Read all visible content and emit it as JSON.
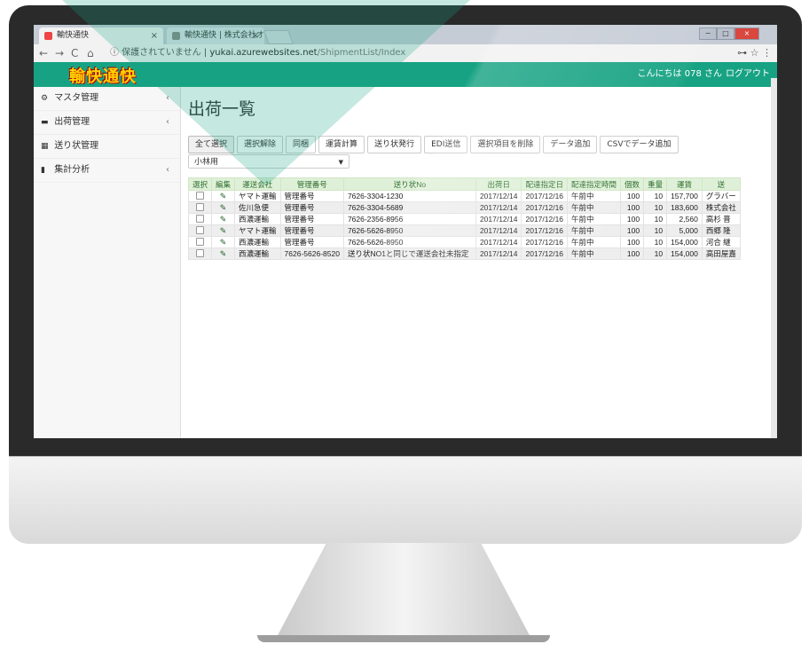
{
  "browser": {
    "tabs": [
      {
        "label": "輸快通快"
      },
      {
        "label": "輸快通快 | 株式会社オ"
      }
    ],
    "window_buttons": [
      "−",
      "□",
      "×"
    ],
    "nav": {
      "back": "←",
      "forward": "→",
      "reload": "C",
      "home": "⌂"
    },
    "address": {
      "secure_label": "ⓘ 保護されていません",
      "host": "yukai.azurewebsites.net",
      "path": "/ShipmentList/Index"
    },
    "addr_icons": {
      "key": "⊶",
      "star": "☆",
      "menu": "⋮"
    }
  },
  "app": {
    "logo_text": "輸快通快",
    "greeting": "こんにちは 078 さん",
    "logout_label": "ログアウト"
  },
  "sidebar": {
    "items": [
      {
        "icon": "⚙",
        "label": "マスタ管理",
        "chevron": "‹"
      },
      {
        "icon": "▬",
        "label": "出荷管理",
        "chevron": "‹"
      },
      {
        "icon": "▦",
        "label": "送り状管理",
        "chevron": ""
      },
      {
        "icon": "▮",
        "label": "集計分析",
        "chevron": "‹"
      }
    ]
  },
  "main": {
    "title": "出荷一覧",
    "buttons": [
      "全て選択",
      "選択解除",
      "同梱",
      "運賃計算",
      "送り状発行",
      "EDI送信",
      "選択項目を削除",
      "データ追加",
      "CSVでデータ追加"
    ],
    "filter_value": "小林用",
    "table": {
      "headers": [
        "選択",
        "編集",
        "運送会社",
        "管理番号",
        "送り状No",
        "出荷日",
        "配達指定日",
        "配達指定時間",
        "個数",
        "重量",
        "運賃",
        "送"
      ],
      "rows": [
        {
          "carrier": "ヤマト運輸",
          "mgmt": "管理番号",
          "invoice": "7626-3304-1230",
          "ship": "2017/12/14",
          "deliver": "2017/12/16",
          "time": "午前中",
          "qty": "100",
          "weight": "10",
          "fare": "157,700",
          "to": "グラバー"
        },
        {
          "carrier": "佐川急便",
          "mgmt": "管理番号",
          "invoice": "7626-3304-5689",
          "ship": "2017/12/14",
          "deliver": "2017/12/16",
          "time": "午前中",
          "qty": "100",
          "weight": "10",
          "fare": "183,600",
          "to": "株式会社"
        },
        {
          "carrier": "西濃運輸",
          "mgmt": "管理番号",
          "invoice": "7626-2356-8956",
          "ship": "2017/12/14",
          "deliver": "2017/12/16",
          "time": "午前中",
          "qty": "100",
          "weight": "10",
          "fare": "2,560",
          "to": "高杉 晋"
        },
        {
          "carrier": "ヤマト運輸",
          "mgmt": "管理番号",
          "invoice": "7626-5626-8950",
          "ship": "2017/12/14",
          "deliver": "2017/12/16",
          "time": "午前中",
          "qty": "100",
          "weight": "10",
          "fare": "5,000",
          "to": "西郷 隆"
        },
        {
          "carrier": "西濃運輸",
          "mgmt": "管理番号",
          "invoice": "7626-5626-8950",
          "ship": "2017/12/14",
          "deliver": "2017/12/16",
          "time": "午前中",
          "qty": "100",
          "weight": "10",
          "fare": "154,000",
          "to": "河合 継"
        },
        {
          "carrier": "西濃運輸",
          "mgmt": "7626-5626-8520",
          "invoice": "送り状NO1と同じで運送会社未指定",
          "ship": "2017/12/14",
          "deliver": "2017/12/16",
          "time": "午前中",
          "qty": "100",
          "weight": "10",
          "fare": "154,000",
          "to": "高田屋嘉"
        }
      ]
    }
  },
  "colors": {
    "brand": "#17a383",
    "header_row": "#dff0d8"
  }
}
